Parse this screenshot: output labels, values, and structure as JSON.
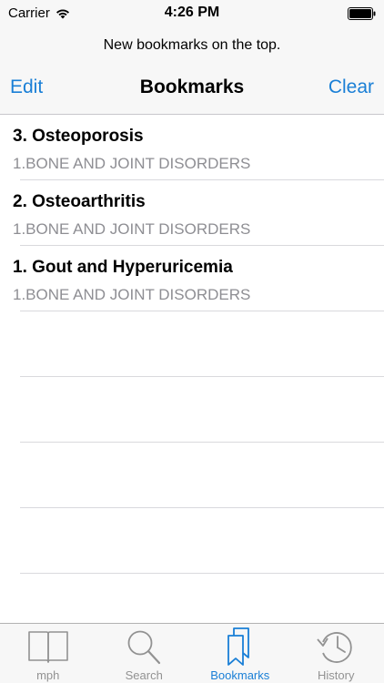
{
  "status_bar": {
    "carrier": "Carrier",
    "time": "4:26 PM"
  },
  "prompt": "New bookmarks on the top.",
  "nav": {
    "edit_label": "Edit",
    "title": "Bookmarks",
    "clear_label": "Clear"
  },
  "bookmarks": [
    {
      "title": "3. Osteoporosis",
      "category": "1.BONE AND JOINT DISORDERS"
    },
    {
      "title": "2. Osteoarthritis",
      "category": "1.BONE AND JOINT DISORDERS"
    },
    {
      "title": "1. Gout and Hyperuricemia",
      "category": "1.BONE AND JOINT DISORDERS"
    }
  ],
  "tabs": [
    {
      "label": "mph",
      "icon": "book-icon",
      "active": false
    },
    {
      "label": "Search",
      "icon": "search-icon",
      "active": false
    },
    {
      "label": "Bookmarks",
      "icon": "bookmarks-icon",
      "active": true
    },
    {
      "label": "History",
      "icon": "history-icon",
      "active": false
    }
  ],
  "colors": {
    "accent": "#1a7fd6",
    "inactive": "#929292",
    "subtitle": "#8e8e93"
  }
}
